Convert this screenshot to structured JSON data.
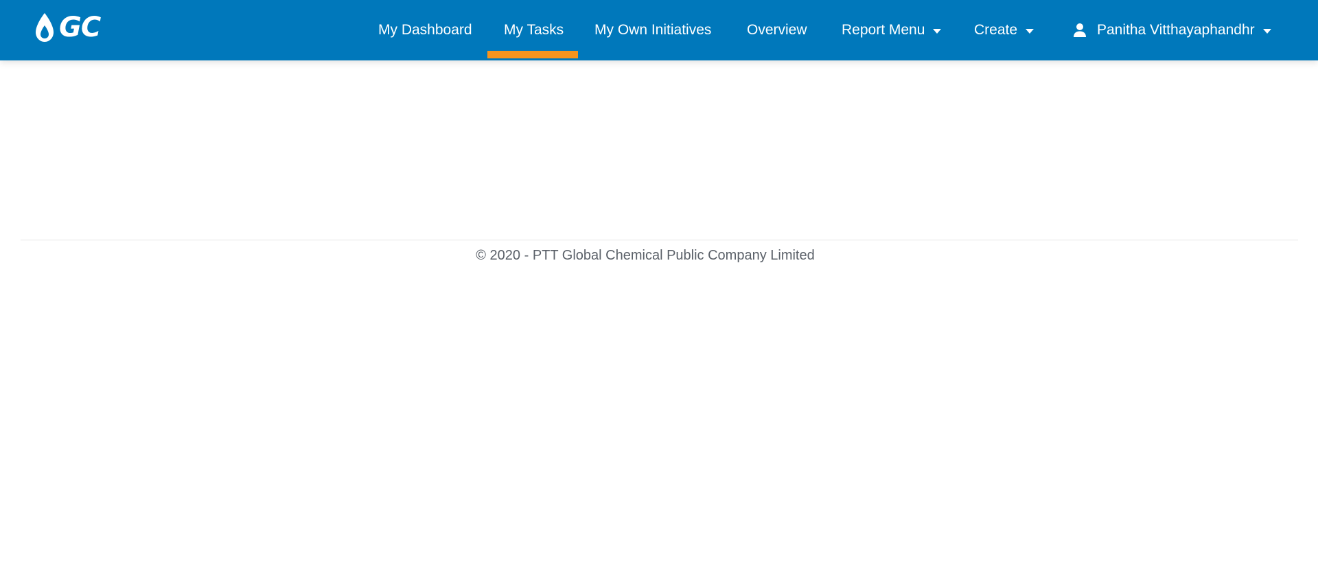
{
  "brand": {
    "logo_text": "GC",
    "icon": "gc-drop-icon",
    "color": "#0078bb",
    "accent": "#f7941d"
  },
  "nav": {
    "items": [
      {
        "label": "My Dashboard",
        "active": false
      },
      {
        "label": "My Tasks",
        "active": true
      },
      {
        "label": "My Own Initiatives",
        "active": false
      },
      {
        "label": "Overview",
        "active": false
      },
      {
        "label": "Report Menu",
        "active": false,
        "dropdown": true
      },
      {
        "label": "Create",
        "active": false,
        "dropdown": true
      }
    ],
    "user": {
      "name": "Panitha Vitthayaphandhr",
      "icon": "user-icon",
      "dropdown": true
    }
  },
  "footer": {
    "copyright": "© 2020 - PTT Global Chemical Public Company Limited"
  }
}
